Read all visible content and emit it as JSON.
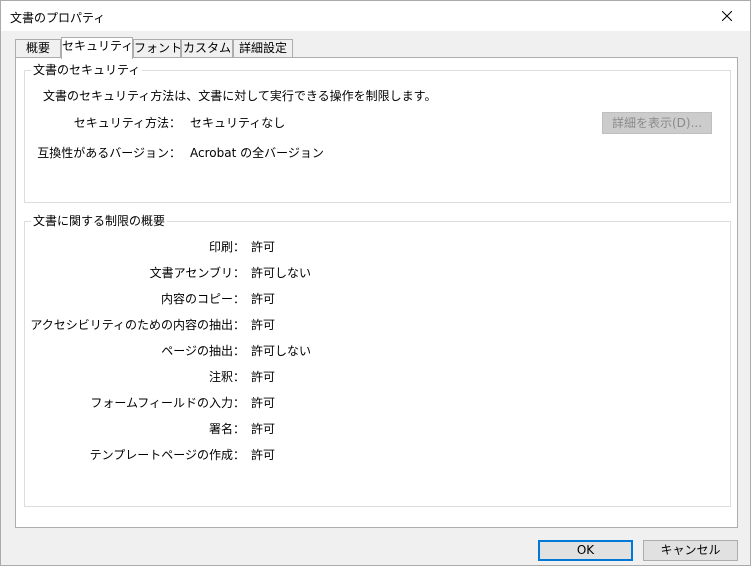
{
  "window": {
    "title": "文書のプロパティ"
  },
  "tabs": [
    {
      "label": "概要"
    },
    {
      "label": "セキュリティ"
    },
    {
      "label": "フォント"
    },
    {
      "label": "カスタム"
    },
    {
      "label": "詳細設定"
    }
  ],
  "security": {
    "group_title": "文書のセキュリティ",
    "description": "文書のセキュリティ方法は、文書に対して実行できる操作を制限します。",
    "method_label": "セキュリティ方法：",
    "method_value": "セキュリティなし",
    "compat_label": "互換性があるバージョン：",
    "compat_value": "Acrobat の全バージョン",
    "details_button": "詳細を表示(D)..."
  },
  "restrictions": {
    "group_title": "文書に関する制限の概要",
    "rows": [
      {
        "label": "印刷：",
        "value": "許可"
      },
      {
        "label": "文書アセンブリ：",
        "value": "許可しない"
      },
      {
        "label": "内容のコピー：",
        "value": "許可"
      },
      {
        "label": "アクセシビリティのための内容の抽出：",
        "value": "許可"
      },
      {
        "label": "ページの抽出：",
        "value": "許可しない"
      },
      {
        "label": "注釈：",
        "value": "許可"
      },
      {
        "label": "フォームフィールドの入力：",
        "value": "許可"
      },
      {
        "label": "署名：",
        "value": "許可"
      },
      {
        "label": "テンプレートページの作成：",
        "value": "許可"
      }
    ]
  },
  "footer": {
    "ok": "OK",
    "cancel": "キャンセル"
  },
  "colors": {
    "accent": "#0078d7",
    "disabled_button": "#cccccc"
  }
}
